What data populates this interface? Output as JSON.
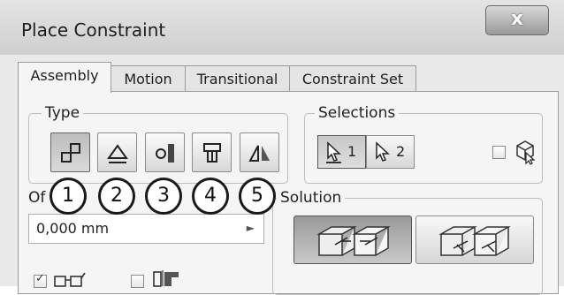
{
  "window": {
    "title": "Place Constraint",
    "close_icon": "close-icon"
  },
  "tabs": [
    {
      "label": "Assembly",
      "active": true
    },
    {
      "label": "Motion",
      "active": false
    },
    {
      "label": "Transitional",
      "active": false
    },
    {
      "label": "Constraint Set",
      "active": false
    }
  ],
  "type_group": {
    "label": "Type",
    "buttons": [
      {
        "name": "mate-constraint",
        "selected": true
      },
      {
        "name": "angle-constraint",
        "selected": false
      },
      {
        "name": "tangent-constraint",
        "selected": false
      },
      {
        "name": "insert-constraint",
        "selected": false
      },
      {
        "name": "symmetry-constraint",
        "selected": false
      }
    ]
  },
  "callouts": [
    "1",
    "2",
    "3",
    "4",
    "5"
  ],
  "selections_group": {
    "label": "Selections",
    "buttons": [
      {
        "number": "1",
        "selected": true
      },
      {
        "number": "2",
        "selected": false
      }
    ]
  },
  "offset": {
    "label": "Of",
    "value": "0,000 mm"
  },
  "solution_group": {
    "label": "Solution",
    "options": [
      {
        "name": "mate",
        "selected": true
      },
      {
        "name": "flush",
        "selected": false
      }
    ]
  },
  "bottom_options": [
    {
      "name": "show-preview",
      "checked": true
    },
    {
      "name": "predict-offset",
      "checked": false
    }
  ]
}
